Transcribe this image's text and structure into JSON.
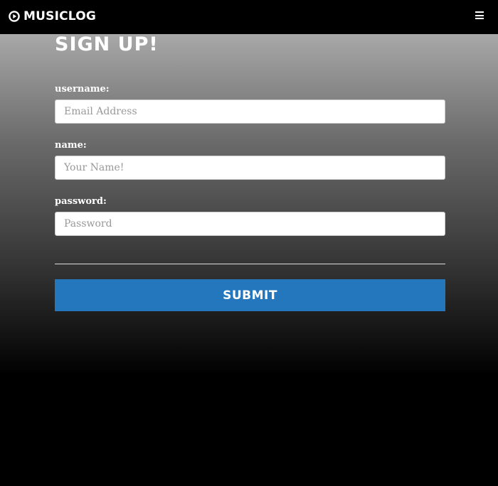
{
  "navbar": {
    "brand": "MUSICLOG",
    "brand_icon": "play-circle-icon",
    "menu_icon": "hamburger-menu-icon"
  },
  "form": {
    "title": "SIGN UP!",
    "fields": [
      {
        "label": "username:",
        "placeholder": "Email Address",
        "value": ""
      },
      {
        "label": "name:",
        "placeholder": "Your Name!",
        "value": ""
      },
      {
        "label": "password:",
        "placeholder": "Password",
        "value": ""
      }
    ],
    "submit_label": "SUBMIT"
  },
  "colors": {
    "navbar_bg": "#000000",
    "submit_bg": "#2577bd",
    "gradient_top": "#a8a8a8",
    "gradient_bottom": "#000000"
  }
}
